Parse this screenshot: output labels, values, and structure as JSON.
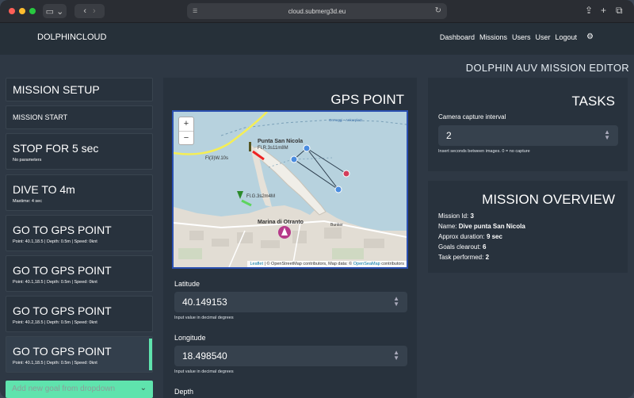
{
  "browser": {
    "url": "cloud.submerg3d.eu"
  },
  "nav": {
    "brand": "DOLPHINCLOUD",
    "links": [
      "Dashboard",
      "Missions",
      "Users",
      "User",
      "Logout"
    ]
  },
  "editor_title": "DOLPHIN AUV MISSION EDITOR",
  "goals": [
    {
      "title": "MISSION SETUP",
      "sub": ""
    },
    {
      "title": "MISSION START",
      "sub": ""
    },
    {
      "title": "STOP FOR 5 sec",
      "sub": "No parameters"
    },
    {
      "title": "DIVE TO 4m",
      "sub": "Maxtime: 4 sec"
    },
    {
      "title": "GO TO GPS POINT",
      "sub": "Point: 40.1,18.5 | Depth: 0.5m | Speed: 0knt"
    },
    {
      "title": "GO TO GPS POINT",
      "sub": "Point: 40.1,18.5 | Depth: 0.5m | Speed: 0knt"
    },
    {
      "title": "GO TO GPS POINT",
      "sub": "Point: 40.2,18.5 | Depth: 0.5m | Speed: 0knt"
    },
    {
      "title": "GO TO GPS POINT",
      "sub": "Point: 40.1,18.5 | Depth: 0.5m | Speed: 0knt"
    }
  ],
  "add_goal_placeholder": "Add new goal from dropdown",
  "gps": {
    "title": "GPS POINT",
    "map": {
      "zoom_in": "+",
      "zoom_out": "−",
      "labels": [
        "Punta San Nicola",
        "Fl.R.3s11m8M",
        "Fl(3)W.10s",
        "Fl.G.3s2m4M",
        "Marina di Otranto",
        "Ormeggi - Ankerplatz",
        "Bunker"
      ],
      "attribution_leaflet": "Leaflet",
      "attribution_text": "| © OpenStreetMap contributors, Map data: ©",
      "attribution_osm": "OpenSeaMap",
      "attribution_end": "contributors"
    },
    "latitude": {
      "label": "Latitude",
      "value": "40.149153",
      "hint": "Input value in decimal degrees"
    },
    "longitude": {
      "label": "Longitude",
      "value": "18.498540",
      "hint": "Input value in decimal degrees"
    },
    "depth": {
      "label": "Depth"
    }
  },
  "tasks": {
    "title": "TASKS",
    "camera_label": "Camera capture interval",
    "camera_value": "2",
    "camera_hint": "Insert seconds between images. 0 = no capture"
  },
  "overview": {
    "title": "MISSION OVERVIEW",
    "rows": [
      {
        "label": "Mission Id:",
        "value": "3"
      },
      {
        "label": "Name:",
        "value": "Dive punta San Nicola"
      },
      {
        "label": "Approx duration:",
        "value": "9 sec"
      },
      {
        "label": "Goals clearout:",
        "value": "6"
      },
      {
        "label": "Task performed:",
        "value": "2"
      }
    ]
  },
  "colors": {
    "accent": "#5fe3ad",
    "panel": "#28323d",
    "background": "#2e3844"
  }
}
